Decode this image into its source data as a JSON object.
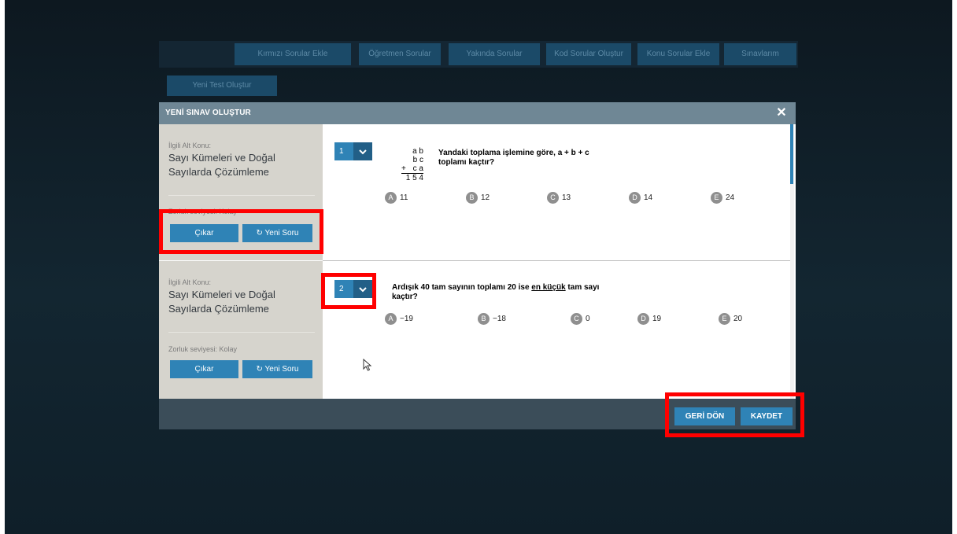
{
  "background": {
    "tabs": [
      "Kırmızı Sorular Ekle",
      "Öğretmen Sorular",
      "Yakında Sorular",
      "Kod Sorular Oluştur",
      "Konu Sorular Ekle",
      "Sınavlarım"
    ],
    "button_label": "Yeni Test Oluştur"
  },
  "modal": {
    "title": "YENİ SINAV OLUŞTUR",
    "close_icon": "close-icon",
    "questions": [
      {
        "topic_label": "İlgili Alt Konu:",
        "topic": "Sayı Kümeleri ve Doğal Sayılarda Çözümleme",
        "difficulty": "Zorluk seviyesi: Kolay",
        "remove_label": "Çıkar",
        "new_label": "Yeni Soru",
        "new_icon": "refresh-icon",
        "number": "1",
        "addition": {
          "line1": "a b",
          "line2": "b c",
          "plus": "+",
          "line3": "c a",
          "sum": "1 5 4"
        },
        "text": "Yandaki toplama işlemine göre, a + b + c toplamı kaçtır?",
        "options": [
          {
            "letter": "A",
            "value": "11"
          },
          {
            "letter": "B",
            "value": "12"
          },
          {
            "letter": "C",
            "value": "13"
          },
          {
            "letter": "D",
            "value": "14"
          },
          {
            "letter": "E",
            "value": "24"
          }
        ]
      },
      {
        "topic_label": "İlgili Alt Konu:",
        "topic": "Sayı Kümeleri ve Doğal Sayılarda Çözümleme",
        "difficulty": "Zorluk seviyesi: Kolay",
        "remove_label": "Çıkar",
        "new_label": "Yeni Soru",
        "new_icon": "refresh-icon",
        "number": "2",
        "text_before": "Ardışık 40 tam sayının toplamı 20 ise ",
        "text_underlined": "en küçük",
        "text_after": " tam sayı kaçtır?",
        "options": [
          {
            "letter": "A",
            "value": "−19"
          },
          {
            "letter": "B",
            "value": "−18"
          },
          {
            "letter": "C",
            "value": "0"
          },
          {
            "letter": "D",
            "value": "19"
          },
          {
            "letter": "E",
            "value": "20"
          }
        ]
      }
    ],
    "footer": {
      "back_label": "GERİ DÖN",
      "save_label": "KAYDET"
    }
  },
  "colors": {
    "accent": "#2f83b6",
    "highlight": "#ff0000",
    "header": "#6f8795"
  }
}
